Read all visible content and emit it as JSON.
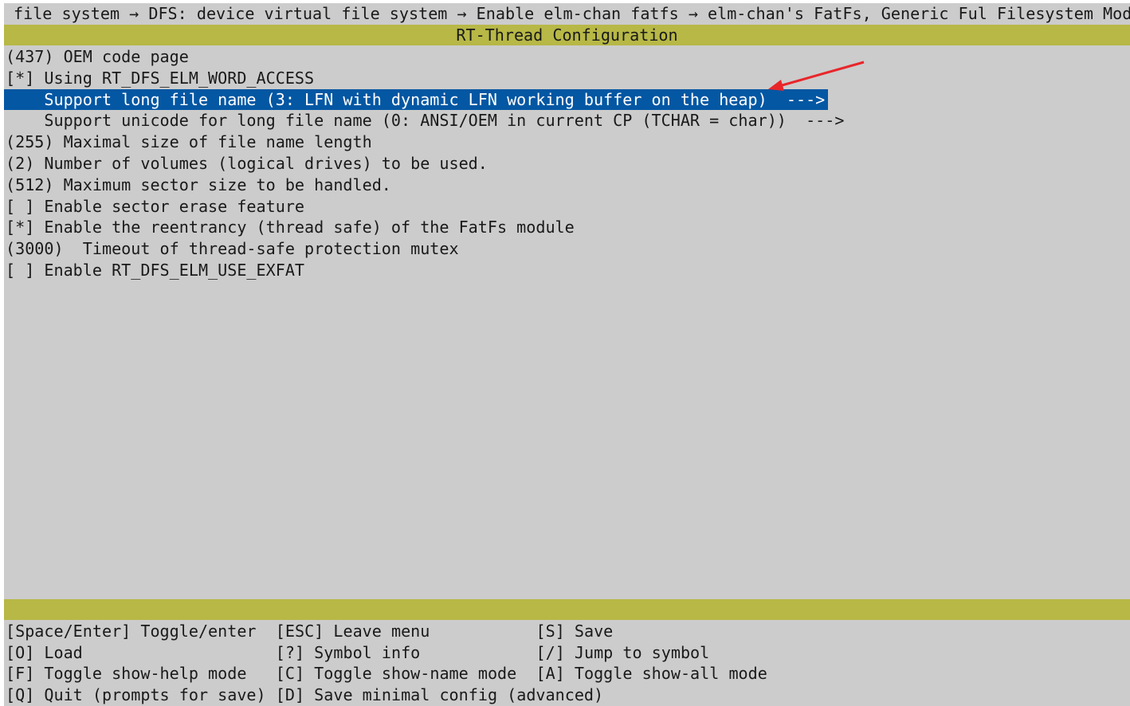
{
  "breadcrumb": "file system → DFS: device virtual file system → Enable elm-chan fatfs → elm-chan's FatFs, Generic Ful Filesystem Module",
  "title": "RT-Thread Configuration",
  "items": [
    {
      "text": "(437) OEM code page",
      "selected": false
    },
    {
      "text": "[*] Using RT_DFS_ELM_WORD_ACCESS",
      "selected": false
    },
    {
      "text": "    Support long file name (3: LFN with dynamic LFN working buffer on the heap)  --->",
      "selected": true
    },
    {
      "text": "    Support unicode for long file name (0: ANSI/OEM in current CP (TCHAR = char))  --->",
      "selected": false
    },
    {
      "text": "(255) Maximal size of file name length",
      "selected": false
    },
    {
      "text": "(2) Number of volumes (logical drives) to be used.",
      "selected": false
    },
    {
      "text": "(512) Maximum sector size to be handled.",
      "selected": false
    },
    {
      "text": "[ ] Enable sector erase feature",
      "selected": false
    },
    {
      "text": "[*] Enable the reentrancy (thread safe) of the FatFs module",
      "selected": false
    },
    {
      "text": "(3000)  Timeout of thread-safe protection mutex",
      "selected": false
    },
    {
      "text": "[ ] Enable RT_DFS_ELM_USE_EXFAT",
      "selected": false
    }
  ],
  "footer": [
    [
      "[Space/Enter] Toggle/enter",
      "[ESC] Leave menu",
      "[S] Save"
    ],
    [
      "[O] Load",
      "[?] Symbol info",
      "[/] Jump to symbol"
    ],
    [
      "[F] Toggle show-help mode",
      "[C] Toggle show-name mode",
      "[A] Toggle show-all mode"
    ],
    [
      "[Q] Quit (prompts for save)",
      "[D] Save minimal config (advanced)",
      ""
    ]
  ],
  "colors": {
    "bar": "#b7b846",
    "selection": "#0457a3",
    "background": "#cccccc",
    "annotation_arrow": "#e8262a"
  },
  "annotation": {
    "icon": "red-arrow-pointing-to-selected-item"
  }
}
